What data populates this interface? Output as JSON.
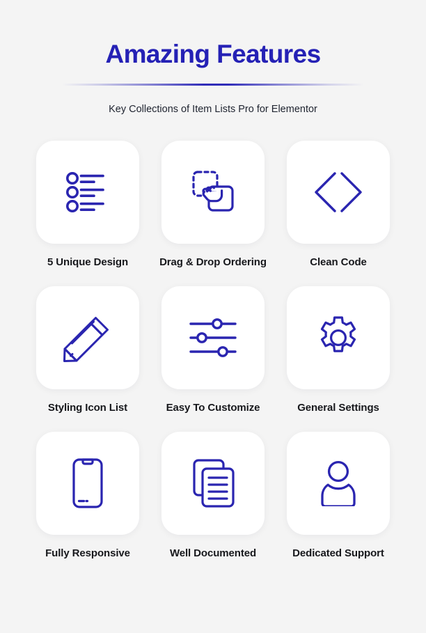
{
  "header": {
    "title": "Amazing Features",
    "subtitle": "Key Collections of Item Lists Pro for Elementor",
    "title_color": "#2521b5",
    "divider_color": "#2521b5"
  },
  "theme": {
    "background": "#f4f4f4",
    "card_background": "#ffffff",
    "icon_color": "#2a25b0",
    "label_color": "#17181c"
  },
  "features": [
    {
      "label": "5 Unique Design",
      "icon": "list-icon"
    },
    {
      "label": "Drag & Drop Ordering",
      "icon": "drag-drop-icon"
    },
    {
      "label": "Clean Code",
      "icon": "code-brackets-icon"
    },
    {
      "label": "Styling Icon List",
      "icon": "pencil-icon"
    },
    {
      "label": "Easy To Customize",
      "icon": "sliders-icon"
    },
    {
      "label": "General Settings",
      "icon": "gear-icon"
    },
    {
      "label": "Fully Responsive",
      "icon": "mobile-phone-icon"
    },
    {
      "label": "Well Documented",
      "icon": "documents-icon"
    },
    {
      "label": "Dedicated Support",
      "icon": "user-person-icon"
    }
  ]
}
